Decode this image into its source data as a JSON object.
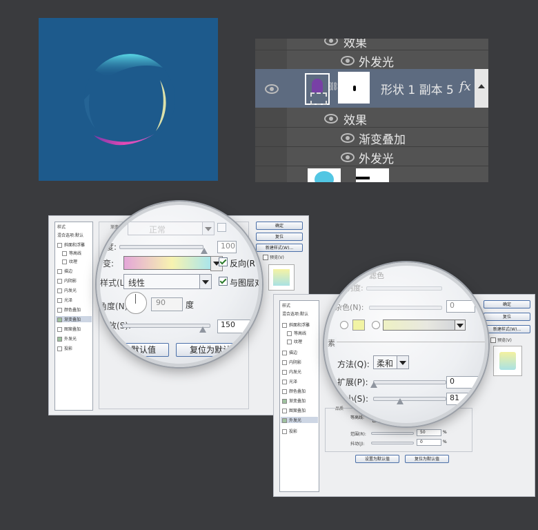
{
  "layers_panel": {
    "rows": [
      {
        "label": "效果",
        "indent": "fx"
      },
      {
        "label": "外发光",
        "indent": "effect"
      },
      {
        "label": "形状 1 副本 5",
        "fx": "fx",
        "selected": true
      },
      {
        "label": "效果",
        "indent": "fx"
      },
      {
        "label": "渐变叠加",
        "indent": "effect"
      },
      {
        "label": "外发光",
        "indent": "effect"
      }
    ],
    "selected_color": "#5d6b80"
  },
  "dialog_gradient": {
    "sidebar_header": "样式",
    "sidebar_items": [
      {
        "label": "混合选项:默认",
        "checked": false
      },
      {
        "label": "斜面和浮雕",
        "checked": false
      },
      {
        "label": "等高线",
        "checked": false
      },
      {
        "label": "纹理",
        "checked": false
      },
      {
        "label": "描边",
        "checked": false
      },
      {
        "label": "内阴影",
        "checked": false
      },
      {
        "label": "内发光",
        "checked": false
      },
      {
        "label": "光泽",
        "checked": false
      },
      {
        "label": "颜色叠加",
        "checked": false
      },
      {
        "label": "渐变叠加",
        "checked": true,
        "active": true
      },
      {
        "label": "图案叠加",
        "checked": false
      },
      {
        "label": "外发光",
        "checked": true
      },
      {
        "label": "投影",
        "checked": false
      }
    ],
    "group_title": "渐变叠加",
    "buttons": [
      "确定",
      "复位",
      "新建样式(W)...",
      "预览(V)"
    ],
    "magnifier": {
      "blend_value": "正常",
      "opacity_label": "度:",
      "opacity_value": "100",
      "gradient_label": "变:",
      "reverse_label": "反向(R",
      "style_label": "样式(L):",
      "style_value": "线性",
      "align_label": "与图层对",
      "angle_label": "角度(N):",
      "angle_value": "90",
      "angle_unit": "度",
      "scale_label": "缩放(S):",
      "scale_value": "150",
      "set_default_btn": "设置为默认值",
      "reset_default_btn": "复位为默认值"
    }
  },
  "dialog_glow": {
    "sidebar_header": "样式",
    "sidebar_items": [
      {
        "label": "混合选项:默认",
        "checked": false
      },
      {
        "label": "斜面和浮雕",
        "checked": false
      },
      {
        "label": "等高线",
        "checked": false
      },
      {
        "label": "纹理",
        "checked": false
      },
      {
        "label": "描边",
        "checked": false
      },
      {
        "label": "内阴影",
        "checked": false
      },
      {
        "label": "内发光",
        "checked": false
      },
      {
        "label": "光泽",
        "checked": false
      },
      {
        "label": "颜色叠加",
        "checked": false
      },
      {
        "label": "渐变叠加",
        "checked": true
      },
      {
        "label": "图案叠加",
        "checked": false
      },
      {
        "label": "外发光",
        "checked": true,
        "active": true
      },
      {
        "label": "投影",
        "checked": false
      }
    ],
    "buttons": [
      "确定",
      "复位",
      "新建样式(W)...",
      "预览(V)"
    ],
    "quality_title": "品质",
    "contour_label": "等高线:",
    "range_label": "范围(R):",
    "range_value": "50",
    "jitter_label": "抖动(J):",
    "jitter_value": "0",
    "percent": "%",
    "set_default_btn": "设置为默认值",
    "reset_default_btn": "复位为默认值",
    "magnifier": {
      "noise_value": "0",
      "percent_short": "%",
      "elements_title": "素",
      "technique_label": "方法(Q):",
      "technique_value": "柔和",
      "spread_label": "扩展(P):",
      "spread_value": "0",
      "size_label": "大小(S):",
      "size_value": "81",
      "blend_label": "混合模式:",
      "blend_value": "滤色",
      "opacity_label": "不透明度:",
      "noise_label": "杂色(N):"
    }
  },
  "colors": {
    "bg": "#3a3b3e",
    "canvas": "#1d5a8c",
    "gradient": [
      "#e4a6d8",
      "#f7f3b0",
      "#a9e5ec"
    ],
    "glow_preview": "#f1f3a4"
  }
}
